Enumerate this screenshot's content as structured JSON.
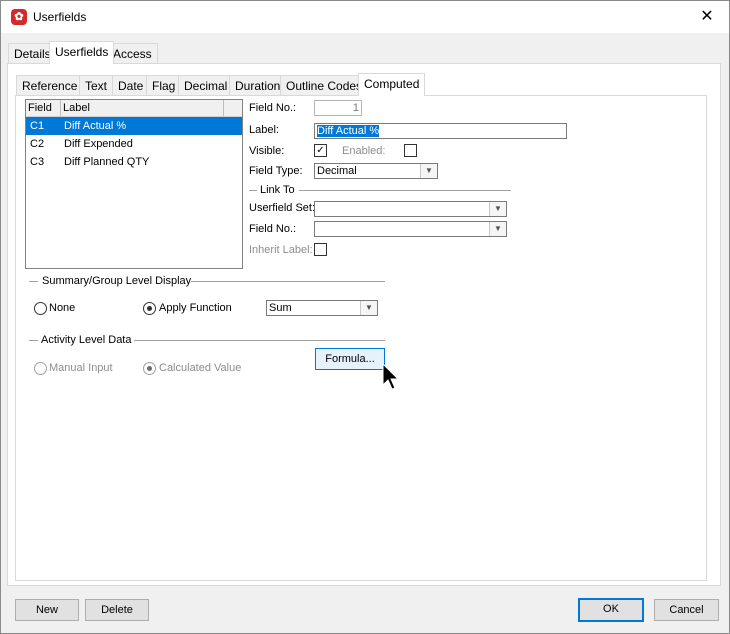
{
  "window": {
    "title": "Userfields",
    "icon": "app-logo-icon",
    "close_icon": "close-icon"
  },
  "outer_tabs": [
    {
      "label": "Details",
      "active": false
    },
    {
      "label": "Userfields",
      "active": true
    },
    {
      "label": "Access",
      "active": false
    }
  ],
  "inner_tabs": [
    {
      "label": "Reference",
      "active": false
    },
    {
      "label": "Text",
      "active": false
    },
    {
      "label": "Date",
      "active": false
    },
    {
      "label": "Flag",
      "active": false
    },
    {
      "label": "Decimal",
      "active": false
    },
    {
      "label": "Duration",
      "active": false
    },
    {
      "label": "Outline Codes",
      "active": false
    },
    {
      "label": "Computed",
      "active": true
    }
  ],
  "list": {
    "headers": [
      "Field",
      "Label"
    ],
    "rows": [
      {
        "field": "C1",
        "label": "Diff Actual %",
        "selected": true
      },
      {
        "field": "C2",
        "label": "Diff Expended",
        "selected": false
      },
      {
        "field": "C3",
        "label": "Diff Planned QTY",
        "selected": false
      }
    ]
  },
  "details": {
    "field_no_label": "Field No.:",
    "field_no_value": "1",
    "label_label": "Label:",
    "label_value": "Diff Actual %",
    "visible_label": "Visible:",
    "visible_checked": true,
    "enabled_label": "Enabled:",
    "enabled_checked": false,
    "field_type_label": "Field Type:",
    "field_type_value": "Decimal"
  },
  "link_to": {
    "group_label": "Link To",
    "userfield_set_label": "Userfield Set:",
    "userfield_set_value": "",
    "field_no_label": "Field No.:",
    "field_no_value": "",
    "inherit_label": "Inherit Label:",
    "inherit_checked": false
  },
  "summary": {
    "group_label": "Summary/Group Level Display",
    "none_label": "None",
    "apply_function_label": "Apply Function",
    "selected": "Apply Function",
    "function_value": "Sum"
  },
  "activity": {
    "group_label": "Activity Level Data",
    "manual_input_label": "Manual Input",
    "calculated_value_label": "Calculated Value",
    "selected": "Calculated Value",
    "formula_button": "Formula..."
  },
  "footer": {
    "new_label": "New",
    "delete_label": "Delete",
    "ok_label": "OK",
    "cancel_label": "Cancel"
  },
  "colors": {
    "selection": "#0078d7",
    "brand": "#d42a2a"
  }
}
